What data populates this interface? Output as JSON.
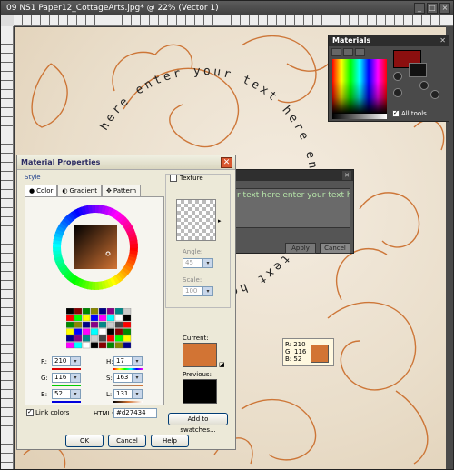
{
  "window": {
    "title": "09 NS1 Paper12_CottageArts.jpg* @ 22% (Vector 1)"
  },
  "canvas": {
    "arc_text": "here enter your text here enter your text here enter your text he",
    "colors": {
      "stroke": "#c8641e",
      "paper": "#efe6d6"
    }
  },
  "materials": {
    "title": "Materials",
    "all_tools": "All tools",
    "all_tools_checked": true,
    "fg_color": "#8b0f0f",
    "bg_color": "#111111"
  },
  "text_entry": {
    "text": "r text here enter your text here",
    "apply": "Apply",
    "cancel": "Cancel"
  },
  "tooltip": {
    "r": "R: 210",
    "g": "G: 116",
    "b": "B: 52",
    "color": "#d27434"
  },
  "material_properties": {
    "title": "Material Properties",
    "style_label": "Style",
    "tabs": [
      "Color",
      "Gradient",
      "Pattern"
    ],
    "texture_label": "Texture",
    "angle_label": "Angle:",
    "angle_value": "45",
    "scale_label": "Scale:",
    "scale_value": "100",
    "current_label": "Current:",
    "previous_label": "Previous:",
    "add_swatches": "Add to swatches...",
    "r_label": "R:",
    "r_value": "210",
    "g_label": "G:",
    "g_value": "116",
    "b_label": "B:",
    "b_value": "52",
    "h_label": "H:",
    "h_value": "17",
    "s_label": "S:",
    "s_value": "163",
    "l_label": "L:",
    "l_value": "131",
    "link_colors": "Link colors",
    "html_label": "HTML:",
    "html_value": "#d27434",
    "ok": "OK",
    "cancel": "Cancel",
    "help": "Help",
    "current_color": "#d27434",
    "previous_color": "#000000"
  }
}
